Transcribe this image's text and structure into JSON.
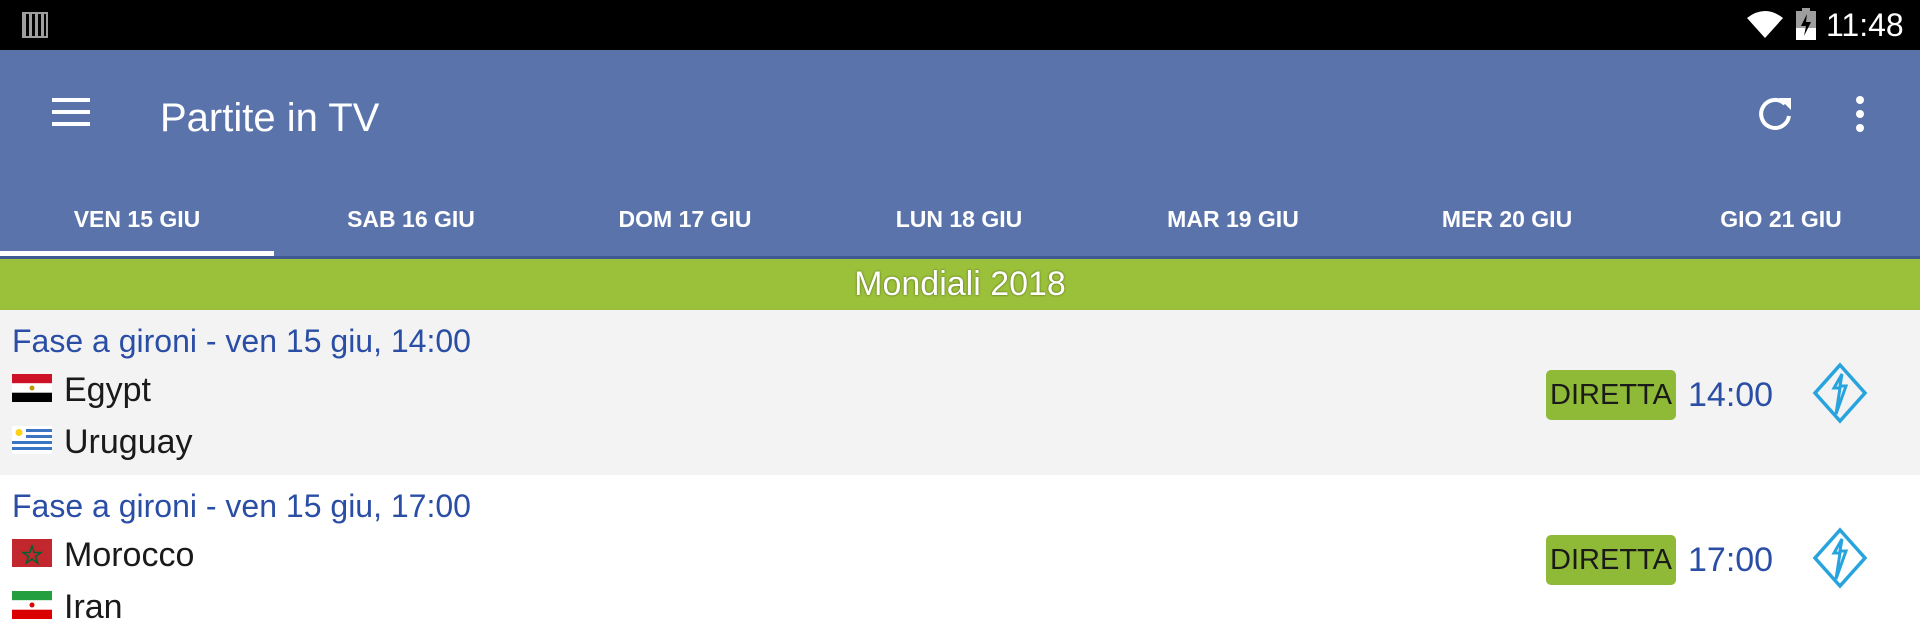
{
  "status_bar": {
    "time": "11:48",
    "icons": [
      "barcode-icon",
      "wifi-icon",
      "battery-charging-icon"
    ]
  },
  "app_bar": {
    "title": "Partite in TV",
    "icons": [
      "menu-icon",
      "refresh-icon",
      "more-vert-icon"
    ],
    "background": "#5a74ab"
  },
  "tabs": [
    {
      "label": "VEN 15 GIU",
      "selected": true
    },
    {
      "label": "SAB 16 GIU",
      "selected": false
    },
    {
      "label": "DOM 17 GIU",
      "selected": false
    },
    {
      "label": "LUN 18 GIU",
      "selected": false
    },
    {
      "label": "MAR 19 GIU",
      "selected": false
    },
    {
      "label": "MER 20 GIU",
      "selected": false
    },
    {
      "label": "GIO 21 GIU",
      "selected": false
    }
  ],
  "section": {
    "title": "Mondiali 2018",
    "background": "#9bc03a"
  },
  "matches": [
    {
      "heading": "Fase a gironi - ven 15 giu, 14:00",
      "home": {
        "name": "Egypt",
        "flag": "egypt-flag-icon"
      },
      "away": {
        "name": "Uruguay",
        "flag": "uruguay-flag-icon"
      },
      "badge": "DIRETTA",
      "time": "14:00",
      "channel_icon": "italia1-logo-icon"
    },
    {
      "heading": "Fase a gironi - ven 15 giu, 17:00",
      "home": {
        "name": "Morocco",
        "flag": "morocco-flag-icon"
      },
      "away": {
        "name": "Iran",
        "flag": "iran-flag-icon"
      },
      "badge": "DIRETTA",
      "time": "17:00",
      "channel_icon": "italia1-logo-icon"
    }
  ],
  "colors": {
    "accent_blue": "#2a4ea5",
    "badge_green": "#8fba37",
    "channel_blue": "#27a4dd"
  }
}
